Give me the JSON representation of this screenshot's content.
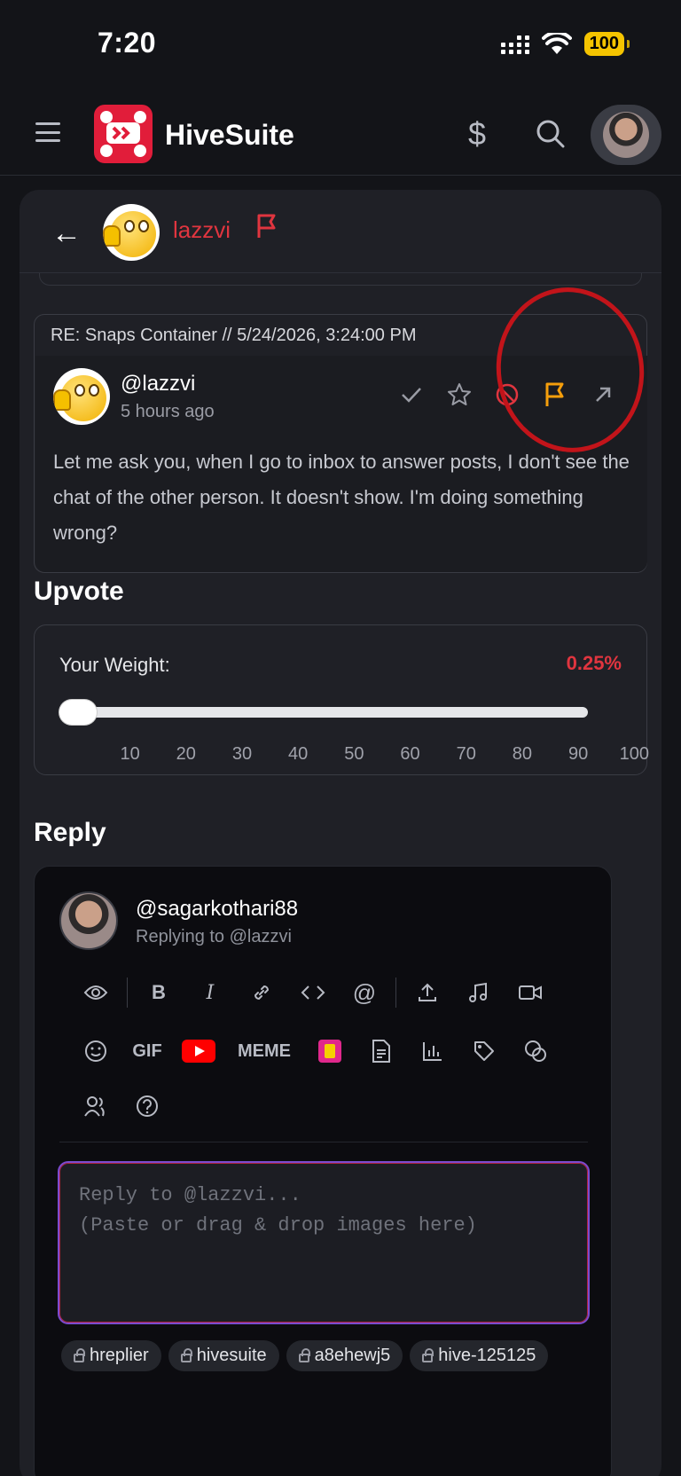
{
  "status_bar": {
    "time": "7:20",
    "battery": "100"
  },
  "header": {
    "title": "HiveSuite"
  },
  "card": {
    "username": "lazzvi"
  },
  "post": {
    "title": "RE: Snaps Container // 5/24/2026, 3:24:00 PM",
    "author": "@lazzvi",
    "time": "5 hours ago",
    "body": "Let me ask you, when I go to inbox to answer posts, I don't see the chat of the other person. It doesn't show. I'm doing something wrong?"
  },
  "upvote": {
    "section_title": "Upvote",
    "weight_label": "Your Weight:",
    "weight_value": "0.25%",
    "weight_fraction": 0.0025,
    "ticks": [
      "10",
      "20",
      "30",
      "40",
      "50",
      "60",
      "70",
      "80",
      "90",
      "100"
    ]
  },
  "reply": {
    "section_title": "Reply",
    "user": "@sagarkothari88",
    "replying_to": "Replying to @lazzvi",
    "toolbar": {
      "gif_label": "GIF",
      "meme_label": "MEME"
    },
    "placeholder": "Reply to @lazzvi...\n(Paste or drag & drop images here)",
    "tags": [
      "hreplier",
      "hivesuite",
      "a8ehewj5",
      "hive-125125"
    ]
  },
  "colors": {
    "accent_red": "#e0353f",
    "annotation_red": "#c2141a",
    "flag_orange": "#f59e0b",
    "battery_yellow": "#f5c400"
  }
}
